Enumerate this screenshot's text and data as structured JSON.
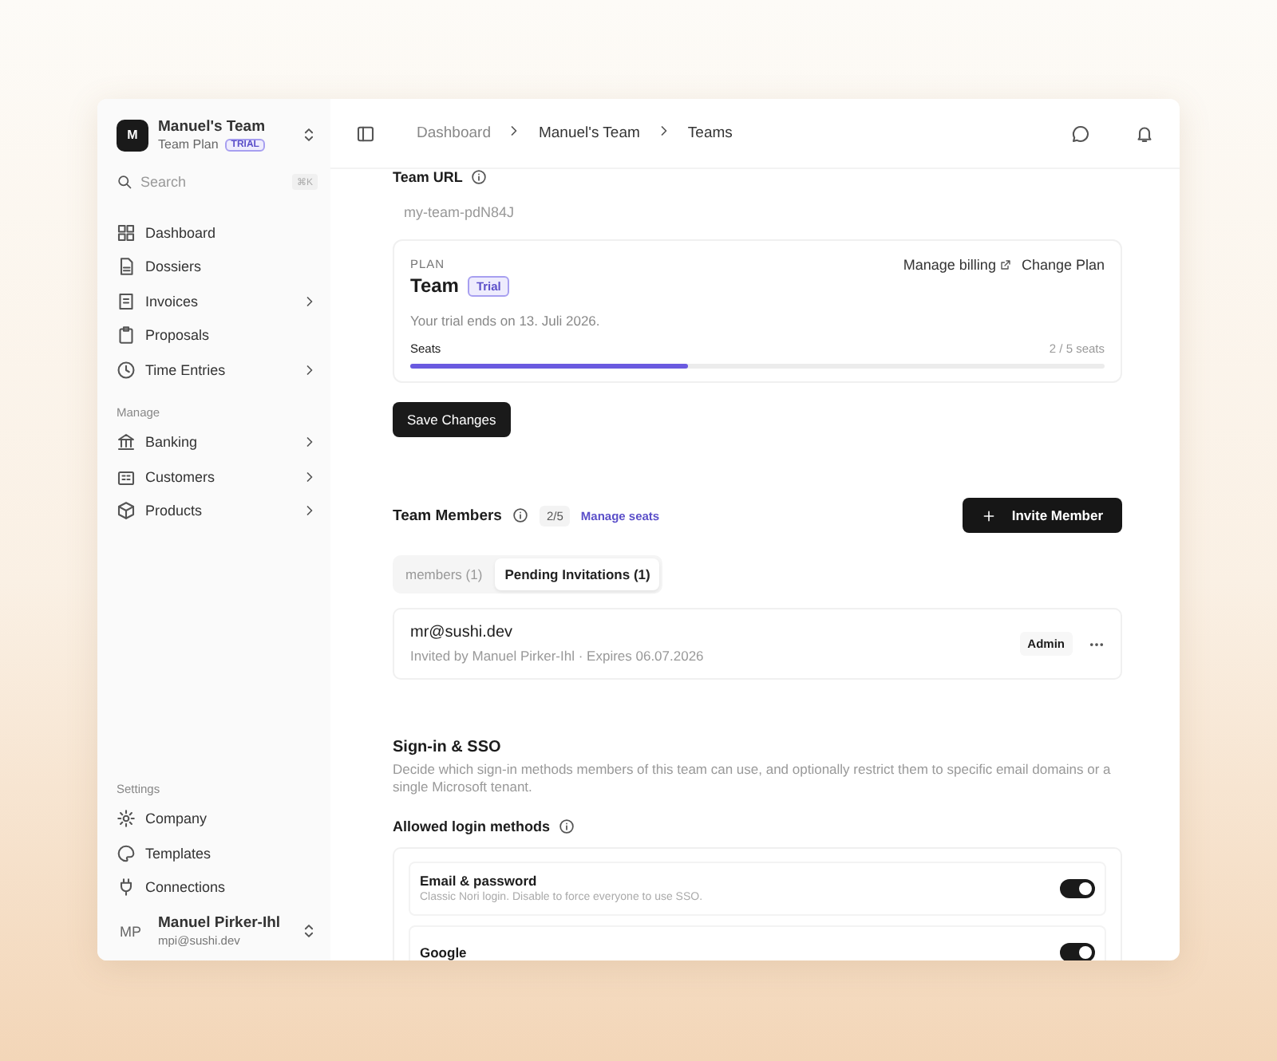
{
  "sidebar": {
    "team": {
      "avatar": "M",
      "name": "Manuel's Team",
      "plan": "Team Plan",
      "badge": "TRIAL"
    },
    "search": {
      "placeholder": "Search",
      "shortcut": "⌘K"
    },
    "sections": [
      {
        "items": [
          {
            "label": "Dashboard",
            "expandable": false
          },
          {
            "label": "Dossiers",
            "expandable": false
          },
          {
            "label": "Invoices",
            "expandable": true
          },
          {
            "label": "Proposals",
            "expandable": false
          },
          {
            "label": "Time Entries",
            "expandable": true
          }
        ]
      },
      {
        "title": "Manage",
        "items": [
          {
            "label": "Banking",
            "expandable": true
          },
          {
            "label": "Customers",
            "expandable": true
          },
          {
            "label": "Products",
            "expandable": true
          }
        ]
      },
      {
        "title": "Settings",
        "items": [
          {
            "label": "Company",
            "expandable": false
          },
          {
            "label": "Templates",
            "expandable": false
          },
          {
            "label": "Connections",
            "expandable": false
          }
        ]
      }
    ],
    "user": {
      "initials": "MP",
      "name": "Manuel Pirker-Ihl",
      "email": "mpi@sushi.dev"
    }
  },
  "breadcrumb": [
    "Dashboard",
    "Manuel's Team",
    "Teams"
  ],
  "team_url": {
    "label": "Team URL",
    "placeholder": "my-team-pdN84J"
  },
  "plan": {
    "eyebrow": "PLAN",
    "name": "Team",
    "badge": "Trial",
    "manage_billing": "Manage billing",
    "change_plan": "Change Plan",
    "trial_note": "Your trial ends on 13. Juli 2026.",
    "seats_label": "Seats",
    "seats_reading": "2 / 5 seats",
    "level": 0.4
  },
  "save_button": "Save Changes",
  "members": {
    "title": "Team Members",
    "count": "2/5",
    "manage_seats": "Manage seats",
    "invite_button": "Invite Member",
    "tabs": [
      {
        "label": "members (1)",
        "selected": false
      },
      {
        "label": "Pending Invitations (1)",
        "selected": true
      }
    ],
    "invitations": [
      {
        "email": "mr@sushi.dev",
        "detail": "Invited by Manuel Pirker-Ihl · Expires 06.07.2026",
        "role": "Admin"
      }
    ]
  },
  "sso": {
    "title": "Sign-in & SSO",
    "description": "Decide which sign-in methods members of this team can use, and optionally restrict them to specific email domains or a single Microsoft tenant.",
    "methods_label": "Allowed login methods",
    "methods": [
      {
        "name": "Email & password",
        "description": "Classic Nori login. Disable to force everyone to use SSO.",
        "on": true
      },
      {
        "name": "Google",
        "on": true
      }
    ]
  }
}
